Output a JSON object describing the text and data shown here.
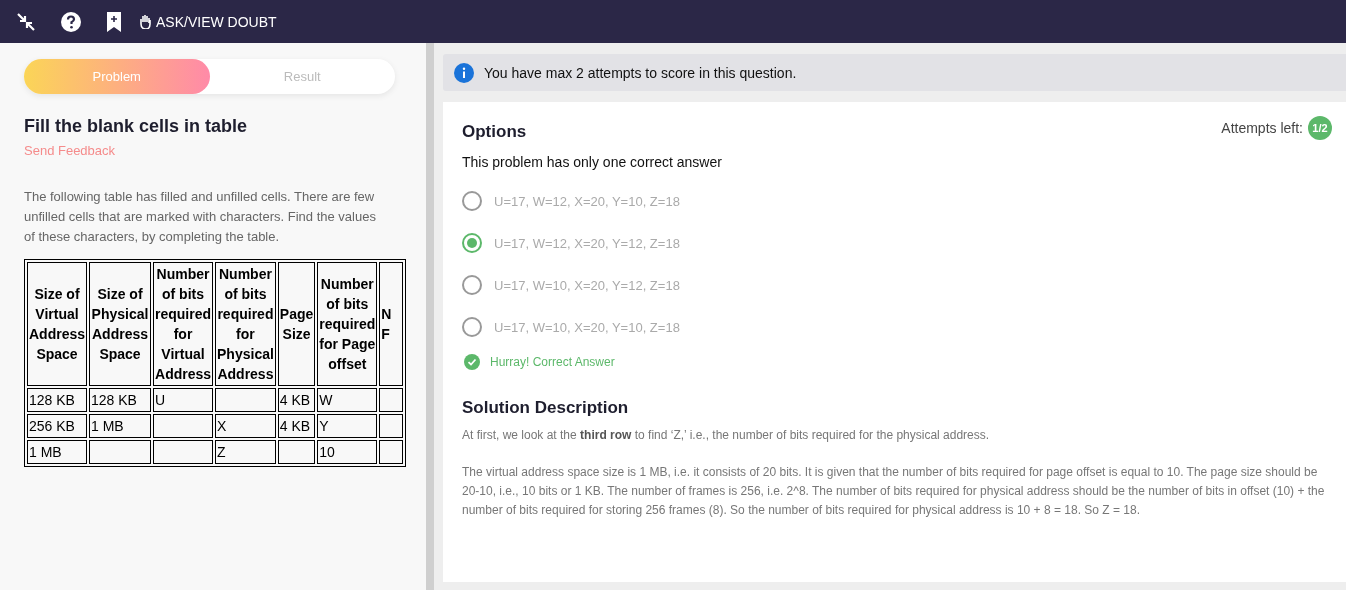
{
  "topbar": {
    "ask_doubt": "ASK/VIEW DOUBT"
  },
  "tabs": [
    {
      "label": "Problem",
      "selected": true
    },
    {
      "label": "Result",
      "selected": false
    }
  ],
  "problem": {
    "title": "Fill the blank cells in table",
    "feedback_link": "Send Feedback",
    "description": "The following table has filled and unfilled cells. There are few unfilled cells that are marked with characters. Find the values of these characters, by completing the table."
  },
  "table": {
    "columns": [
      "Size of Virtual Address Space",
      "Size of Physical Address Space",
      "Number of bits required for Virtual Address",
      "Number of bits required for Physical Address",
      "Page Size",
      "Number of bits required for Page offset",
      "N F"
    ],
    "rows": [
      [
        "128 KB",
        "128 KB",
        "U",
        "",
        "4 KB",
        "W",
        ""
      ],
      [
        "256 KB",
        "1 MB",
        "",
        "X",
        "4 KB",
        "Y",
        ""
      ],
      [
        "1 MB",
        "",
        "",
        "Z",
        "",
        "10",
        ""
      ]
    ]
  },
  "notice": "You have max 2 attempts to score in this question.",
  "options": {
    "heading": "Options",
    "attempts_label": "Attempts left:",
    "attempts_value": "1/2",
    "subtitle": "This problem has only one correct answer",
    "choices": [
      {
        "label": "U=17, W=12, X=20, Y=10, Z=18",
        "selected": false
      },
      {
        "label": "U=17, W=12, X=20, Y=12, Z=18",
        "selected": true
      },
      {
        "label": "U=17, W=10, X=20, Y=12, Z=18",
        "selected": false
      },
      {
        "label": "U=17, W=10, X=20, Y=10, Z=18",
        "selected": false
      }
    ],
    "result": {
      "correct": true,
      "text": "Hurray! Correct Answer"
    }
  },
  "solution": {
    "heading": "Solution Description",
    "paragraphs": [
      "At first, we look at the **third row** to find ‘Z,’ i.e., the number of bits required for the physical address.",
      "The virtual address space size is 1 MB, i.e. it consists of 20 bits. It is given that the number of bits required for page offset is equal to 10. The page size should be 20-10, i.e., 10 bits or 1 KB. The number of frames is 256, i.e. 2^8. The number of bits required for physical address should be the number of bits in offset (10) + the number of bits required for storing 256 frames (8). So the number of bits required for physical address is 10 + 8 = 18. So Z = 18."
    ]
  }
}
